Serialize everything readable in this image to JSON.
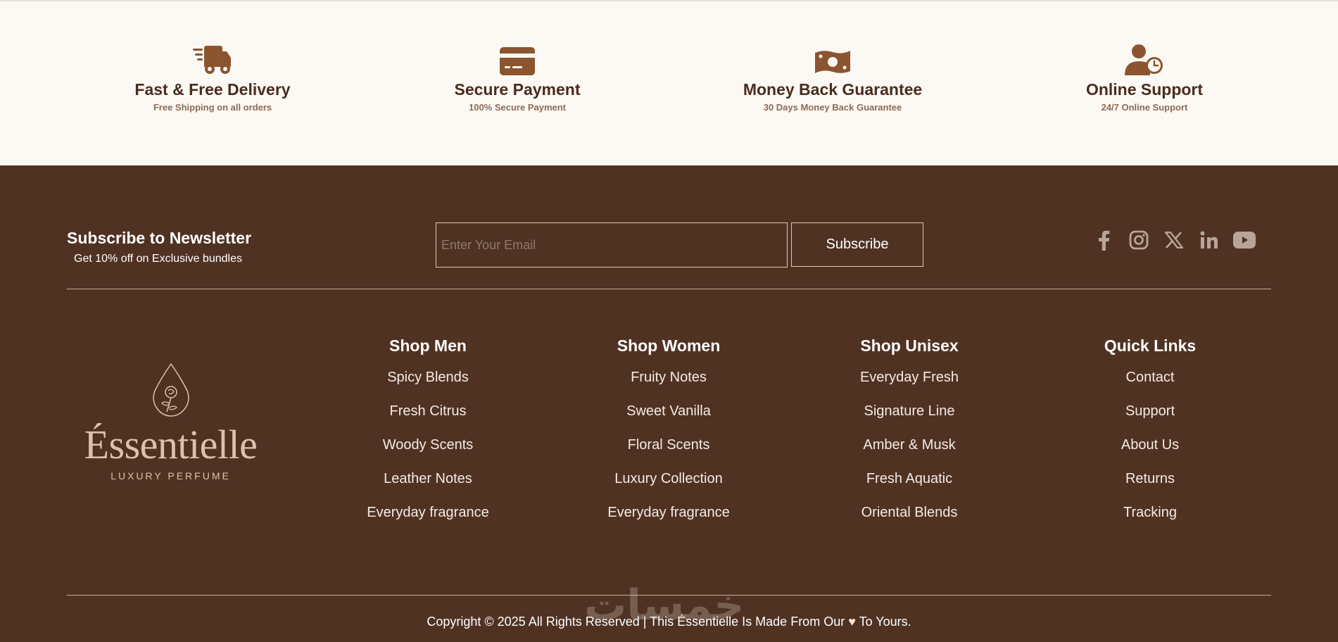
{
  "features": [
    {
      "icon": "truck-icon",
      "title": "Fast & Free Delivery",
      "subtitle": "Free Shipping on all orders"
    },
    {
      "icon": "credit-card-icon",
      "title": "Secure Payment",
      "subtitle": "100% Secure Payment"
    },
    {
      "icon": "money-icon",
      "title": "Money Back Guarantee",
      "subtitle": "30 Days Money Back Guarantee"
    },
    {
      "icon": "support-user-icon",
      "title": "Online Support",
      "subtitle": "24/7 Online Support"
    }
  ],
  "newsletter": {
    "title": "Subscribe to Newsletter",
    "subtitle": "Get 10% off on Exclusive bundles",
    "email_placeholder": "Enter Your Email",
    "email_value": "",
    "button_label": "Subscribe"
  },
  "socials": [
    "facebook-icon",
    "instagram-icon",
    "x-twitter-icon",
    "linkedin-icon",
    "youtube-icon"
  ],
  "logo": {
    "brand": "Éssentielle",
    "tagline": "LUXURY PERFUME"
  },
  "columns": [
    {
      "title": "Shop Men",
      "links": [
        "Spicy Blends",
        "Fresh Citrus",
        "Woody Scents",
        "Leather Notes",
        "Everyday fragrance"
      ]
    },
    {
      "title": "Shop Women",
      "links": [
        "Fruity Notes",
        "Sweet Vanilla",
        "Floral Scents",
        "Luxury Collection",
        "Everyday fragrance"
      ]
    },
    {
      "title": "Shop Unisex",
      "links": [
        "Everyday Fresh",
        "Signature Line",
        "Amber & Musk",
        "Fresh Aquatic",
        "Oriental Blends"
      ]
    },
    {
      "title": "Quick Links",
      "links": [
        "Contact",
        "Support",
        "About Us",
        "Returns",
        "Tracking"
      ]
    }
  ],
  "copyright": {
    "before": "Copyright © 2025 All Rights Reserved | This Éssentielle Is Made From Our",
    "heart": "♥",
    "after": "To Yours."
  },
  "watermark": "خمسات",
  "colors": {
    "footer_bg": "#503223",
    "accent_brown": "#8b5530",
    "feature_bg": "#fcf9f4",
    "border_gold": "#e6c9a8"
  }
}
